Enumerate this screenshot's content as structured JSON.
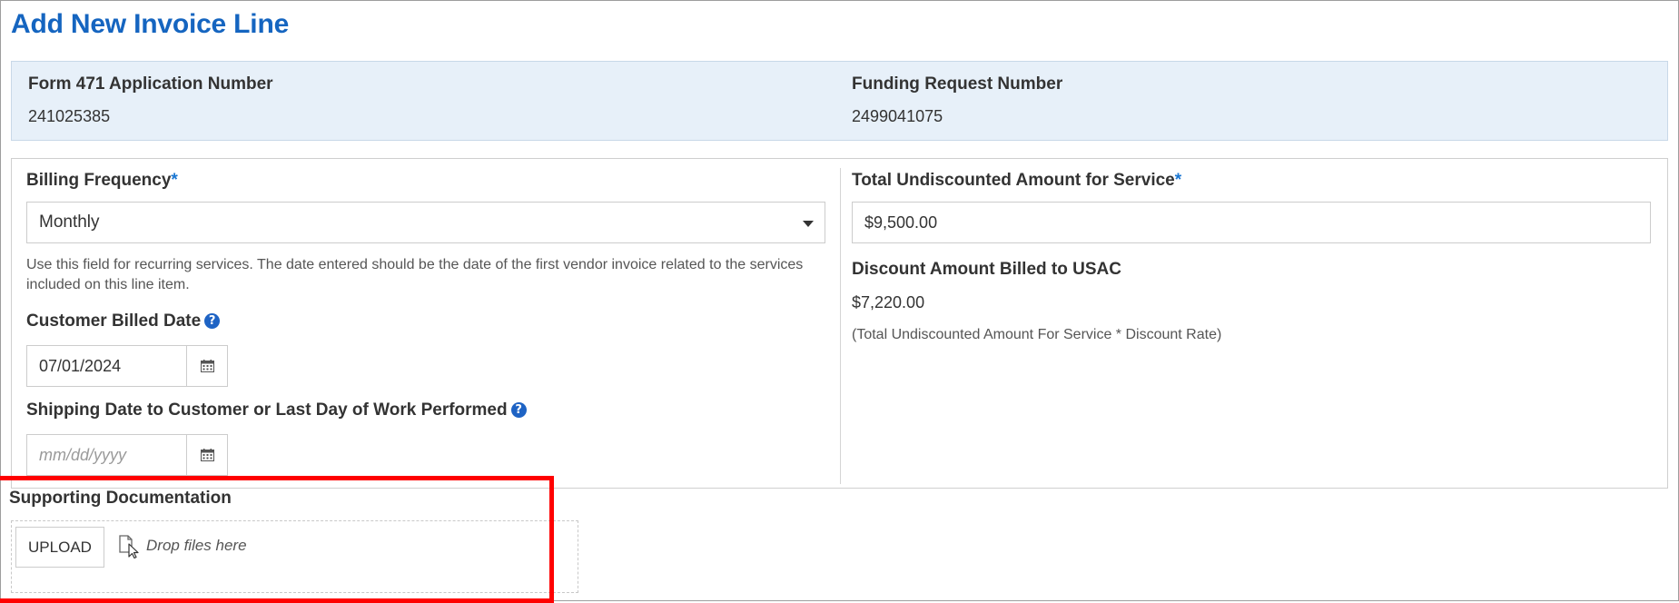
{
  "page": {
    "title": "Add New Invoice Line"
  },
  "info": {
    "application_number_label": "Form 471 Application Number",
    "application_number_value": "241025385",
    "frn_label": "Funding Request Number",
    "frn_value": "2499041075"
  },
  "form": {
    "billing_frequency": {
      "label": "Billing Frequency",
      "required_mark": "*",
      "selected_value": "Monthly"
    },
    "help_text": "Use this field for recurring services. The date entered should be the date of the first vendor invoice related to the services included on this line item.",
    "customer_billed_date": {
      "label": "Customer Billed Date",
      "value": "07/01/2024",
      "help_glyph": "?"
    },
    "shipping_date": {
      "label": "Shipping Date to Customer or Last Day of Work Performed",
      "placeholder": "mm/dd/yyyy",
      "help_glyph": "?"
    },
    "total_undiscounted": {
      "label": "Total Undiscounted Amount for Service",
      "required_mark": "*",
      "value": "$9,500.00"
    },
    "discount_amount": {
      "label": "Discount Amount Billed to USAC",
      "value": "$7,220.00",
      "formula": "(Total Undiscounted Amount For Service * Discount Rate)"
    }
  },
  "supporting_documentation": {
    "label": "Supporting Documentation",
    "upload_label": "UPLOAD",
    "drop_text": "Drop files here"
  },
  "colors": {
    "title_blue": "#1565c0",
    "info_bg": "#e7f0f9",
    "help_icon_blue": "#1e63c4",
    "highlight_red": "#ff0000"
  },
  "icons": {
    "calendar": "calendar-icon",
    "help": "question-circle-icon",
    "drop": "file-pointer-icon",
    "select_caret": "caret-down-icon"
  }
}
